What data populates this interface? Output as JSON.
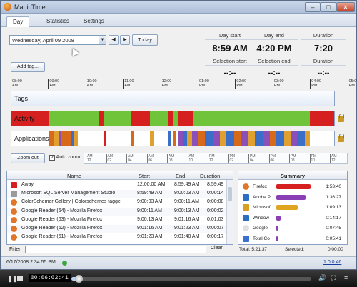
{
  "window": {
    "title": "ManicTime"
  },
  "tabs": [
    {
      "label": "Day",
      "active": true
    },
    {
      "label": "Statistics",
      "active": false
    },
    {
      "label": "Settings",
      "active": false
    }
  ],
  "date_picker": {
    "value": "Wednesday, April 09 2008",
    "today_label": "Today"
  },
  "day_summary": {
    "day_start_label": "Day start",
    "day_start": "8:59 AM",
    "day_end_label": "Day end",
    "day_end": "4:20 PM",
    "duration_label": "Duration",
    "duration": "7:20"
  },
  "selection": {
    "start_label": "Selection start",
    "start": "--:--",
    "end_label": "Selection end",
    "end": "--:--",
    "duration_label": "Duration",
    "duration": "--:--"
  },
  "add_tag_label": "Add tag...",
  "ruler_ticks": [
    {
      "h": "08:00",
      "ap": "AM"
    },
    {
      "h": "09:00",
      "ap": "AM"
    },
    {
      "h": "10:00",
      "ap": "AM"
    },
    {
      "h": "11:00",
      "ap": "AM"
    },
    {
      "h": "12:00",
      "ap": "PM"
    },
    {
      "h": "01:00",
      "ap": "PM"
    },
    {
      "h": "02:00",
      "ap": "PM"
    },
    {
      "h": "03:00",
      "ap": "PM"
    },
    {
      "h": "04:00",
      "ap": "PM"
    },
    {
      "h": "05:00",
      "ap": "PM"
    }
  ],
  "timeline": {
    "tags_label": "Tags",
    "activity_label": "Activity",
    "applications_label": "Applications"
  },
  "activity_segments": [
    {
      "start": 0.0,
      "end": 0.115,
      "color": "#d62020"
    },
    {
      "start": 0.115,
      "end": 0.27,
      "color": "#6fc43a"
    },
    {
      "start": 0.27,
      "end": 0.285,
      "color": "#d62020"
    },
    {
      "start": 0.285,
      "end": 0.37,
      "color": "#6fc43a"
    },
    {
      "start": 0.37,
      "end": 0.43,
      "color": "#d62020"
    },
    {
      "start": 0.43,
      "end": 0.485,
      "color": "#6fc43a"
    },
    {
      "start": 0.485,
      "end": 0.5,
      "color": "#d62020"
    },
    {
      "start": 0.5,
      "end": 0.515,
      "color": "#6fc43a"
    },
    {
      "start": 0.515,
      "end": 0.565,
      "color": "#d62020"
    },
    {
      "start": 0.565,
      "end": 0.925,
      "color": "#6fc43a"
    },
    {
      "start": 0.925,
      "end": 1.0,
      "color": "#d62020"
    }
  ],
  "app_segments": [
    {
      "start": 0.115,
      "end": 0.13,
      "color": "#d66a1a"
    },
    {
      "start": 0.13,
      "end": 0.145,
      "color": "#e0a030"
    },
    {
      "start": 0.145,
      "end": 0.155,
      "color": "#8a4fb8"
    },
    {
      "start": 0.155,
      "end": 0.185,
      "color": "#d66a1a"
    },
    {
      "start": 0.185,
      "end": 0.195,
      "color": "#3a6ec8"
    },
    {
      "start": 0.195,
      "end": 0.205,
      "color": "#e0a030"
    },
    {
      "start": 0.285,
      "end": 0.295,
      "color": "#d62020"
    },
    {
      "start": 0.37,
      "end": 0.38,
      "color": "#d66a1a"
    },
    {
      "start": 0.43,
      "end": 0.44,
      "color": "#e0a030"
    },
    {
      "start": 0.485,
      "end": 0.495,
      "color": "#3a6ec8"
    },
    {
      "start": 0.5,
      "end": 0.51,
      "color": "#d66a1a"
    },
    {
      "start": 0.515,
      "end": 0.53,
      "color": "#8a4fb8"
    },
    {
      "start": 0.53,
      "end": 0.545,
      "color": "#3a6ec8"
    },
    {
      "start": 0.545,
      "end": 0.56,
      "color": "#e0a030"
    },
    {
      "start": 0.56,
      "end": 0.58,
      "color": "#8a4fb8"
    },
    {
      "start": 0.58,
      "end": 0.6,
      "color": "#d66a1a"
    },
    {
      "start": 0.6,
      "end": 0.625,
      "color": "#3a6ec8"
    },
    {
      "start": 0.625,
      "end": 0.645,
      "color": "#8a4fb8"
    },
    {
      "start": 0.645,
      "end": 0.665,
      "color": "#e0a030"
    },
    {
      "start": 0.665,
      "end": 0.69,
      "color": "#3a6ec8"
    },
    {
      "start": 0.69,
      "end": 0.71,
      "color": "#d66a1a"
    },
    {
      "start": 0.71,
      "end": 0.735,
      "color": "#8a4fb8"
    },
    {
      "start": 0.735,
      "end": 0.755,
      "color": "#e0a030"
    },
    {
      "start": 0.755,
      "end": 0.78,
      "color": "#3a6ec8"
    },
    {
      "start": 0.78,
      "end": 0.8,
      "color": "#8a4fb8"
    },
    {
      "start": 0.8,
      "end": 0.82,
      "color": "#d66a1a"
    },
    {
      "start": 0.82,
      "end": 0.845,
      "color": "#3a6ec8"
    },
    {
      "start": 0.845,
      "end": 0.865,
      "color": "#e0a030"
    },
    {
      "start": 0.865,
      "end": 0.885,
      "color": "#8a4fb8"
    },
    {
      "start": 0.885,
      "end": 0.91,
      "color": "#3a6ec8"
    },
    {
      "start": 0.91,
      "end": 0.925,
      "color": "#e0a030"
    }
  ],
  "zoom": {
    "zoom_out_label": "Zoom out",
    "auto_zoom_label": "Auto zoom",
    "auto_zoom_checked": true
  },
  "mini_ruler_ticks": [
    {
      "h": "AM",
      "n": "12"
    },
    {
      "h": "AM",
      "n": "02"
    },
    {
      "h": "AM",
      "n": "04"
    },
    {
      "h": "AM",
      "n": "06"
    },
    {
      "h": "AM",
      "n": "08"
    },
    {
      "h": "AM",
      "n": "10"
    },
    {
      "h": "PM",
      "n": "12"
    },
    {
      "h": "PM",
      "n": "02"
    },
    {
      "h": "PM",
      "n": "04"
    },
    {
      "h": "PM",
      "n": "06"
    },
    {
      "h": "PM",
      "n": "08"
    },
    {
      "h": "PM",
      "n": "10"
    },
    {
      "h": "AM",
      "n": "12"
    }
  ],
  "list": {
    "headers": {
      "name": "Name",
      "start": "Start",
      "end": "End",
      "duration": "Duration"
    },
    "rows": [
      {
        "icon": "away-icon",
        "color": "#d62020",
        "name": "Away",
        "start": "12:00:00 AM",
        "end": "8:59:49 AM",
        "duration": "8:59:49"
      },
      {
        "icon": "sql-server-icon",
        "color": "#9a9a9a",
        "name": "Microsoft SQL Server Management Studio",
        "start": "8:59:49 AM",
        "end": "9:00:03 AM",
        "duration": "0:00:14"
      },
      {
        "icon": "firefox-icon",
        "color": "#e0762a",
        "name": "ColorSchemer Gallery | Colorschemes tagge",
        "start": "9:00:03 AM",
        "end": "9:00:11 AM",
        "duration": "0:00:08"
      },
      {
        "icon": "firefox-icon",
        "color": "#e0762a",
        "name": "Google Reader (64) - Mozilla Firefox",
        "start": "9:00:11 AM",
        "end": "9:00:13 AM",
        "duration": "0:00:02"
      },
      {
        "icon": "firefox-icon",
        "color": "#e0762a",
        "name": "Google Reader (63) - Mozilla Firefox",
        "start": "9:00:13 AM",
        "end": "9:01:16 AM",
        "duration": "0:01:03"
      },
      {
        "icon": "firefox-icon",
        "color": "#e0762a",
        "name": "Google Reader (62) - Mozilla Firefox",
        "start": "9:01:16 AM",
        "end": "9:01:23 AM",
        "duration": "0:00:07"
      },
      {
        "icon": "firefox-icon",
        "color": "#e0762a",
        "name": "Google Reader (61) - Mozilla Firefox",
        "start": "9:01:23 AM",
        "end": "9:01:40 AM",
        "duration": "0:00:17"
      }
    ]
  },
  "filter": {
    "label": "Filter",
    "value": "",
    "clear_label": "Clear"
  },
  "summary": {
    "title": "Summary",
    "rows": [
      {
        "icon": "firefox-icon",
        "color": "#e0762a",
        "name": "Firefox",
        "time": "1:53:40",
        "fraction": 1.0,
        "bar_color": "#d62020"
      },
      {
        "icon": "adobe-photoshop-icon",
        "color": "#2b6fc4",
        "name": "Adobe P",
        "time": "1:36:27",
        "fraction": 0.86,
        "bar_color": "#8a3fb5"
      },
      {
        "icon": "microsoft-icon",
        "color": "#d8a020",
        "name": "Microsof",
        "time": "1:09:13",
        "fraction": 0.62,
        "bar_color": "#e0a520"
      },
      {
        "icon": "windows-icon",
        "color": "#2b6fc4",
        "name": "Window",
        "time": "0:14:17",
        "fraction": 0.13,
        "bar_color": "#8a3fb5"
      },
      {
        "icon": "google-icon",
        "color": "#e0e0e0",
        "name": "Google",
        "time": "0:07:45",
        "fraction": 0.07,
        "bar_color": "#8a3fb5"
      },
      {
        "icon": "total-commander-icon",
        "color": "#3b6fd0",
        "name": "Total Co",
        "time": "0:05:41",
        "fraction": 0.0,
        "bar_color": "#8a3fb5"
      }
    ],
    "total_label": "Total:",
    "total": "5:21:37",
    "selected_label": "Selected:",
    "selected": "0:00:00"
  },
  "status": {
    "datetime": "6/17/2008 2:34:55 PM",
    "version": "1.0.0.46"
  },
  "player": {
    "time": "00:06:02:41",
    "progress": 0.03
  }
}
